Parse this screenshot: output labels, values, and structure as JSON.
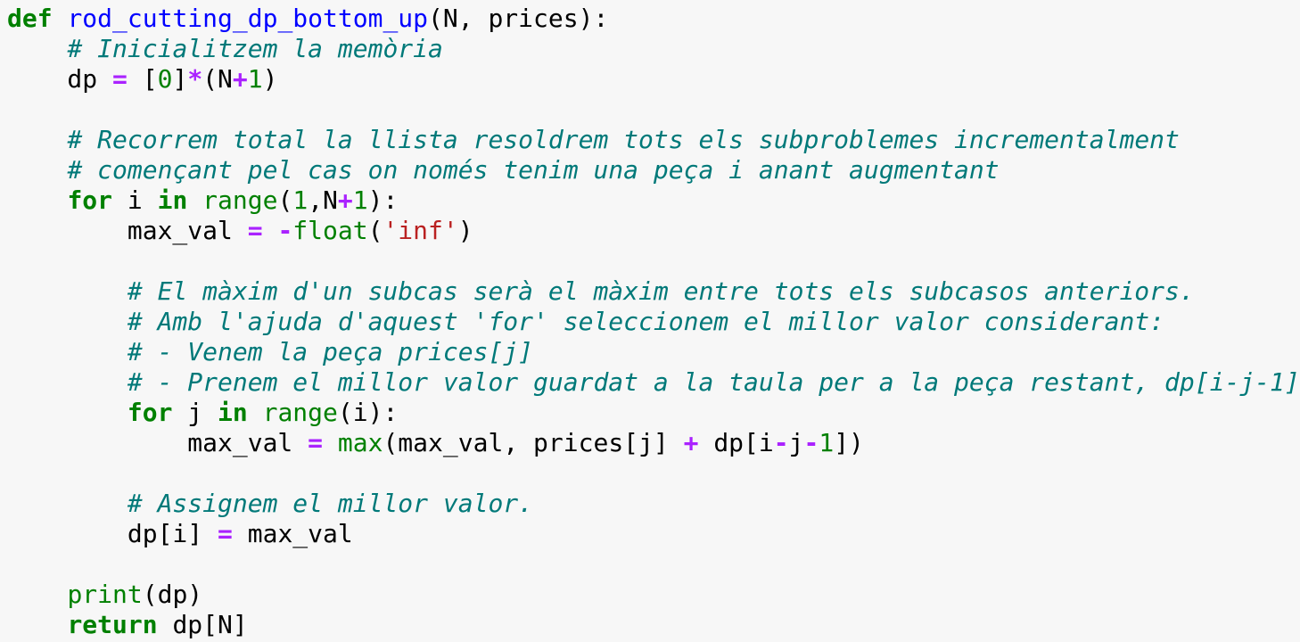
{
  "code": {
    "lines": [
      [
        {
          "t": "def",
          "c": "kw"
        },
        {
          "t": " ",
          "c": "tx"
        },
        {
          "t": "rod_cutting_dp_bottom_up",
          "c": "fn"
        },
        {
          "t": "(N, prices):",
          "c": "tx"
        }
      ],
      [
        {
          "t": "    ",
          "c": "tx"
        },
        {
          "t": "# Inicialitzem la memòria",
          "c": "cm"
        }
      ],
      [
        {
          "t": "    dp ",
          "c": "tx"
        },
        {
          "t": "=",
          "c": "op"
        },
        {
          "t": " [",
          "c": "tx"
        },
        {
          "t": "0",
          "c": "num"
        },
        {
          "t": "]",
          "c": "tx"
        },
        {
          "t": "*",
          "c": "op"
        },
        {
          "t": "(N",
          "c": "tx"
        },
        {
          "t": "+",
          "c": "op"
        },
        {
          "t": "1",
          "c": "num"
        },
        {
          "t": ")",
          "c": "tx"
        }
      ],
      [],
      [
        {
          "t": "    ",
          "c": "tx"
        },
        {
          "t": "# Recorrem total la llista resoldrem tots els subproblemes incrementalment",
          "c": "cm"
        }
      ],
      [
        {
          "t": "    ",
          "c": "tx"
        },
        {
          "t": "# començant pel cas on només tenim una peça i anant augmentant",
          "c": "cm"
        }
      ],
      [
        {
          "t": "    ",
          "c": "tx"
        },
        {
          "t": "for",
          "c": "kw"
        },
        {
          "t": " i ",
          "c": "tx"
        },
        {
          "t": "in",
          "c": "kw"
        },
        {
          "t": " ",
          "c": "tx"
        },
        {
          "t": "range",
          "c": "bi"
        },
        {
          "t": "(",
          "c": "tx"
        },
        {
          "t": "1",
          "c": "num"
        },
        {
          "t": ",N",
          "c": "tx"
        },
        {
          "t": "+",
          "c": "op"
        },
        {
          "t": "1",
          "c": "num"
        },
        {
          "t": "):",
          "c": "tx"
        }
      ],
      [
        {
          "t": "        max_val ",
          "c": "tx"
        },
        {
          "t": "=",
          "c": "op"
        },
        {
          "t": " ",
          "c": "tx"
        },
        {
          "t": "-",
          "c": "op"
        },
        {
          "t": "float",
          "c": "bi"
        },
        {
          "t": "(",
          "c": "tx"
        },
        {
          "t": "'inf'",
          "c": "str"
        },
        {
          "t": ")",
          "c": "tx"
        }
      ],
      [],
      [
        {
          "t": "        ",
          "c": "tx"
        },
        {
          "t": "# El màxim d'un subcas serà el màxim entre tots els subcasos anteriors.",
          "c": "cm"
        }
      ],
      [
        {
          "t": "        ",
          "c": "tx"
        },
        {
          "t": "# Amb l'ajuda d'aquest 'for' seleccionem el millor valor considerant:",
          "c": "cm"
        }
      ],
      [
        {
          "t": "        ",
          "c": "tx"
        },
        {
          "t": "# - Venem la peça prices[j]",
          "c": "cm"
        }
      ],
      [
        {
          "t": "        ",
          "c": "tx"
        },
        {
          "t": "# - Prenem el millor valor guardat a la taula per a la peça restant, dp[i-j-1]",
          "c": "cm"
        }
      ],
      [
        {
          "t": "        ",
          "c": "tx"
        },
        {
          "t": "for",
          "c": "kw"
        },
        {
          "t": " j ",
          "c": "tx"
        },
        {
          "t": "in",
          "c": "kw"
        },
        {
          "t": " ",
          "c": "tx"
        },
        {
          "t": "range",
          "c": "bi"
        },
        {
          "t": "(i):",
          "c": "tx"
        }
      ],
      [
        {
          "t": "            max_val ",
          "c": "tx"
        },
        {
          "t": "=",
          "c": "op"
        },
        {
          "t": " ",
          "c": "tx"
        },
        {
          "t": "max",
          "c": "bi"
        },
        {
          "t": "(max_val, prices[j] ",
          "c": "tx"
        },
        {
          "t": "+",
          "c": "op"
        },
        {
          "t": " dp[i",
          "c": "tx"
        },
        {
          "t": "-",
          "c": "op"
        },
        {
          "t": "j",
          "c": "tx"
        },
        {
          "t": "-",
          "c": "op"
        },
        {
          "t": "1",
          "c": "num"
        },
        {
          "t": "])",
          "c": "tx"
        }
      ],
      [],
      [
        {
          "t": "        ",
          "c": "tx"
        },
        {
          "t": "# Assignem el millor valor.",
          "c": "cm"
        }
      ],
      [
        {
          "t": "        dp[i] ",
          "c": "tx"
        },
        {
          "t": "=",
          "c": "op"
        },
        {
          "t": " max_val",
          "c": "tx"
        }
      ],
      [],
      [
        {
          "t": "    ",
          "c": "tx"
        },
        {
          "t": "print",
          "c": "bi"
        },
        {
          "t": "(dp)",
          "c": "tx"
        }
      ],
      [
        {
          "t": "    ",
          "c": "tx"
        },
        {
          "t": "return",
          "c": "kw"
        },
        {
          "t": " dp[N]",
          "c": "tx"
        }
      ]
    ]
  }
}
